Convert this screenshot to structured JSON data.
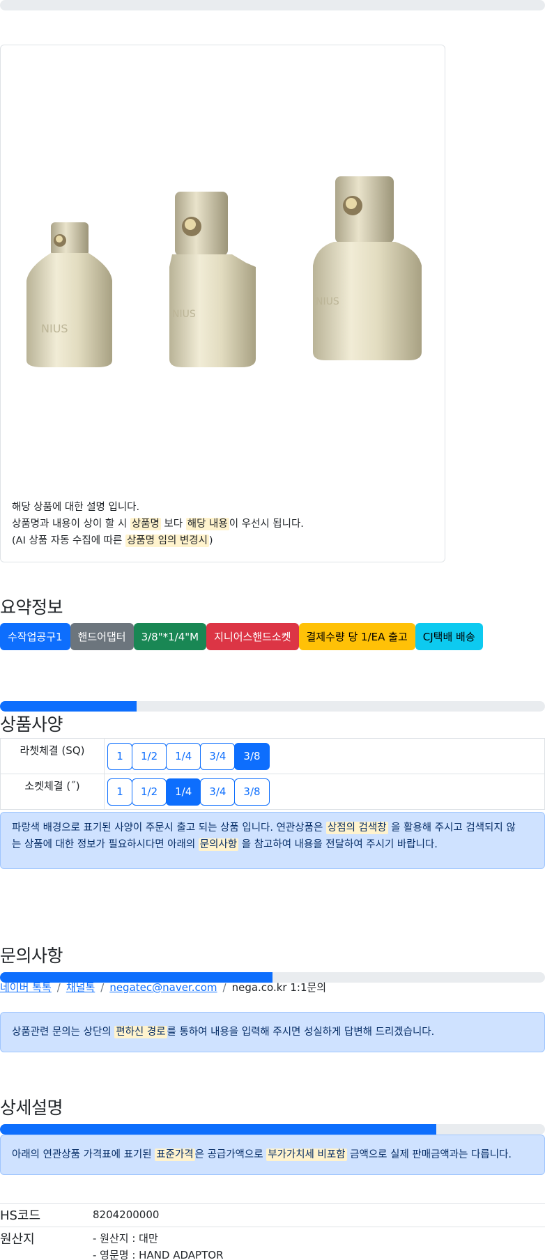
{
  "top_progress": {
    "value": 0
  },
  "product": {
    "image_alt": "socket adaptors",
    "desc_line1": "해당 상품에 대한 설명 입니다.",
    "desc_line2_a": "상품명과 내용이 상이 할 시 ",
    "desc_line2_hl1": "상품명",
    "desc_line2_b": " 보다 ",
    "desc_line2_hl2": "해당 내용",
    "desc_line2_c": "이 우선시 됩니다.",
    "desc_line3_a": "(AI 상품 자동 수집에 따른 ",
    "desc_line3_hl": "상품명 임의 변경시",
    "desc_line3_b": ")"
  },
  "summary": {
    "title": "요약정보",
    "badges": [
      {
        "label": "수작업공구1",
        "color": "#0d6efd",
        "text": "#ffffff"
      },
      {
        "label": "핸드어댑터",
        "color": "#6c757d",
        "text": "#ffffff"
      },
      {
        "label": "3/8\"*1/4\"M",
        "color": "#198754",
        "text": "#ffffff"
      },
      {
        "label": "지니어스핸드소켓",
        "color": "#dc3545",
        "text": "#ffffff"
      },
      {
        "label": "결제수량 당 1/EA 출고",
        "color": "#ffc107",
        "text": "#000000"
      },
      {
        "label": "CJ택배 배송",
        "color": "#0dcaf0",
        "text": "#000000"
      }
    ]
  },
  "spec": {
    "title": "상품사양",
    "progress": 25,
    "rows": [
      {
        "label": "라쳇체결 (SQ)",
        "options": [
          "1",
          "1/2",
          "1/4",
          "3/4",
          "3/8"
        ],
        "selected": "3/8"
      },
      {
        "label": "소켓체결 (˝)",
        "options": [
          "1",
          "1/2",
          "1/4",
          "3/4",
          "3/8"
        ],
        "selected": "1/4"
      }
    ],
    "notice_a": "파랑색 배경으로 표기된 사양이 주문시 출고 되는 상품 입니다. 연관상품은 ",
    "notice_hl1": "상점의 검색창",
    "notice_b": " 을 활용해 주시고 검색되지 않",
    "notice_c": "는 상품에 대한 정보가 필요하시다면 아래의 ",
    "notice_hl2": "문의사항",
    "notice_d": " 을 참고하여 내용을 전달하여 주시기 바랍니다."
  },
  "inquiry": {
    "title": "문의사항",
    "progress": 50,
    "links": [
      "네이버 톡톡",
      "채널톡",
      "negatec@naver.com"
    ],
    "plain": "nega.co.kr 1:1문의",
    "notice_a": "상품관련 문의는 상단의 ",
    "notice_hl": "편하신 경로",
    "notice_b": "를 통하여 내용을 입력해 주시면 성실하게 답변해 드리겠습니다."
  },
  "detail": {
    "title": "상세설명",
    "progress": 80,
    "notice_a": "아래의 연관상품 가격표에 표기된 ",
    "notice_hl1": "표준가격",
    "notice_b": "은 공급가액으로 ",
    "notice_hl2": "부가가치세 비포함",
    "notice_c": " 금액으로 실제 판매금액과는 다릅니다.",
    "hs_label": "HS코드",
    "hs_value": "8204200000",
    "origin_label": "원산지",
    "origin_line1": "- 원산지 : 대만",
    "origin_line2": "- 영문명 : HAND ADAPTOR"
  }
}
